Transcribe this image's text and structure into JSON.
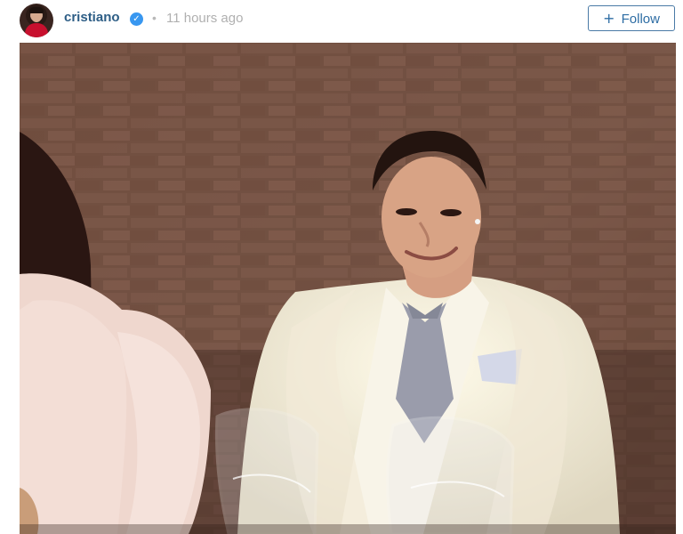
{
  "post": {
    "username": "cristiano",
    "separator": "•",
    "timestamp": "11 hours ago",
    "follow_plus": "+",
    "follow_label": "Follow"
  },
  "icons": {
    "avatar": "profile-avatar",
    "verified": "verified-badge-icon",
    "follow": "plus-icon"
  },
  "colors": {
    "username": "#2e5e86",
    "verified": "#3897f0",
    "follow_border": "#4a7aa6",
    "timestamp": "#b0b0b0"
  }
}
